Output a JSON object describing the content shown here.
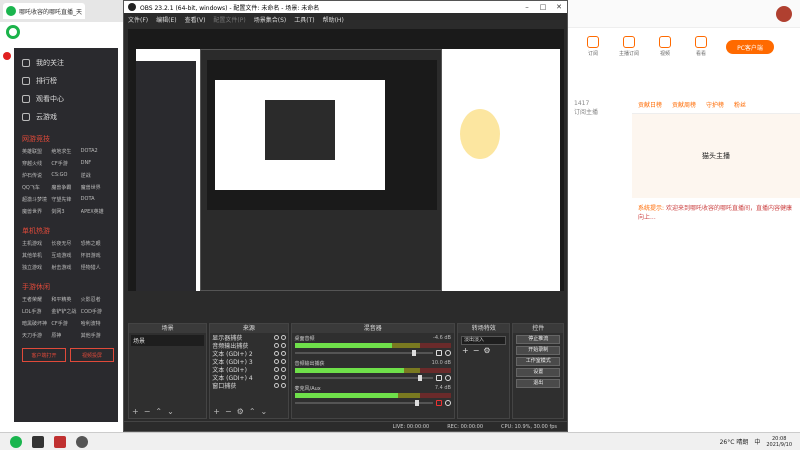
{
  "browser": {
    "tab_title": "哪吒收容的哪吒直播_天猫精灵力",
    "sidebar_items": [
      {
        "label": "我的关注"
      },
      {
        "label": "排行榜"
      },
      {
        "label": "观看中心"
      },
      {
        "label": "云游戏"
      }
    ],
    "sidebar_sections": [
      {
        "title": "网游竞技",
        "games": [
          "英雄联盟",
          "绝地求生",
          "DOTA2",
          "穿越火线",
          "CF手游",
          "DNF",
          "炉石传说",
          "CS:GO",
          "逆战",
          "QQ飞车",
          "魔兽争霸",
          "魔兽世界",
          "超激斗梦境",
          "守望先锋",
          "DOTA",
          "魔兽世界",
          "剑网3",
          "APEX英雄"
        ]
      },
      {
        "title": "单机热游",
        "games": [
          "主机游戏",
          "长夜无尽",
          "恐怖之眼",
          "其他单机",
          "互动游戏",
          "怀旧游戏",
          "独立游戏",
          "射击游戏",
          "怪物猎人"
        ]
      },
      {
        "title": "手游休闲",
        "games": [
          "王者荣耀",
          "和平精英",
          "火影忍者",
          "LOL手游",
          "金铲铲之战",
          "COD手游",
          "暗黑破坏神",
          "CF手游",
          "哈利波特",
          "天刀手游",
          "原神",
          "其他手游"
        ]
      }
    ],
    "bottom_buttons": [
      {
        "label": "客户端打开"
      },
      {
        "label": "视频投屏"
      }
    ]
  },
  "site": {
    "nav": [
      {
        "label": "订阅"
      },
      {
        "label": "主播订阅"
      },
      {
        "label": "视频"
      },
      {
        "label": "看看"
      }
    ],
    "pc_button": "PC客户端",
    "left_stats": [
      "1417",
      "订阅主播"
    ],
    "room_tabs": [
      "贡献日榜",
      "贡献周榜",
      "守护榜",
      "粉丝"
    ],
    "banner_text": "猫头主播",
    "chat_tip": "系统提示:",
    "chat_text": "欢迎来到哪吒收容的哪吒直播间，直播内容健康向上..."
  },
  "obs": {
    "title": "OBS 23.2.1 (64-bit, windows) - 配置文件: 未命名 - 场景: 未命名",
    "menu": [
      "文件(F)",
      "编辑(E)",
      "查看(V)",
      "配置文件(P)",
      "场景集合(S)",
      "工具(T)",
      "帮助(H)"
    ],
    "docks": {
      "scenes": {
        "title": "场景",
        "items": [
          "场景"
        ]
      },
      "sources": {
        "title": "来源",
        "items": [
          "显示器捕获",
          "音频输出捕获",
          "文本 (GDI+) 2",
          "文本 (GDI+) 3",
          "文本 (GDI+)",
          "文本 (GDI+) 4",
          "窗口捕获"
        ]
      },
      "mixer": {
        "title": "混音器",
        "channels": [
          {
            "name": "桌面音频",
            "db": "-4.6 dB",
            "level": 0.62,
            "volume": 0.88,
            "muted": false
          },
          {
            "name": "音频输出捕获",
            "db": "10.0 dB",
            "level": 0.7,
            "volume": 0.92,
            "muted": false
          },
          {
            "name": "麦克风/Aux",
            "db": "7.4 dB",
            "level": 0.66,
            "volume": 0.9,
            "muted": true
          }
        ]
      },
      "transitions": {
        "title": "转场特效",
        "selected": "淡出淡入"
      },
      "controls": {
        "title": "控件",
        "buttons": [
          "停止推流",
          "开始录制",
          "工作室模式",
          "设置",
          "退出"
        ]
      }
    },
    "status": {
      "live": "LIVE: 00:00:00",
      "rec": "REC: 00:00:00",
      "cpu": "CPU: 10.9%, 30.00 fps"
    }
  },
  "taskbar": {
    "weather": "26°C 晴朗",
    "ime": "中",
    "time": "20:08",
    "date": "2021/9/10"
  }
}
